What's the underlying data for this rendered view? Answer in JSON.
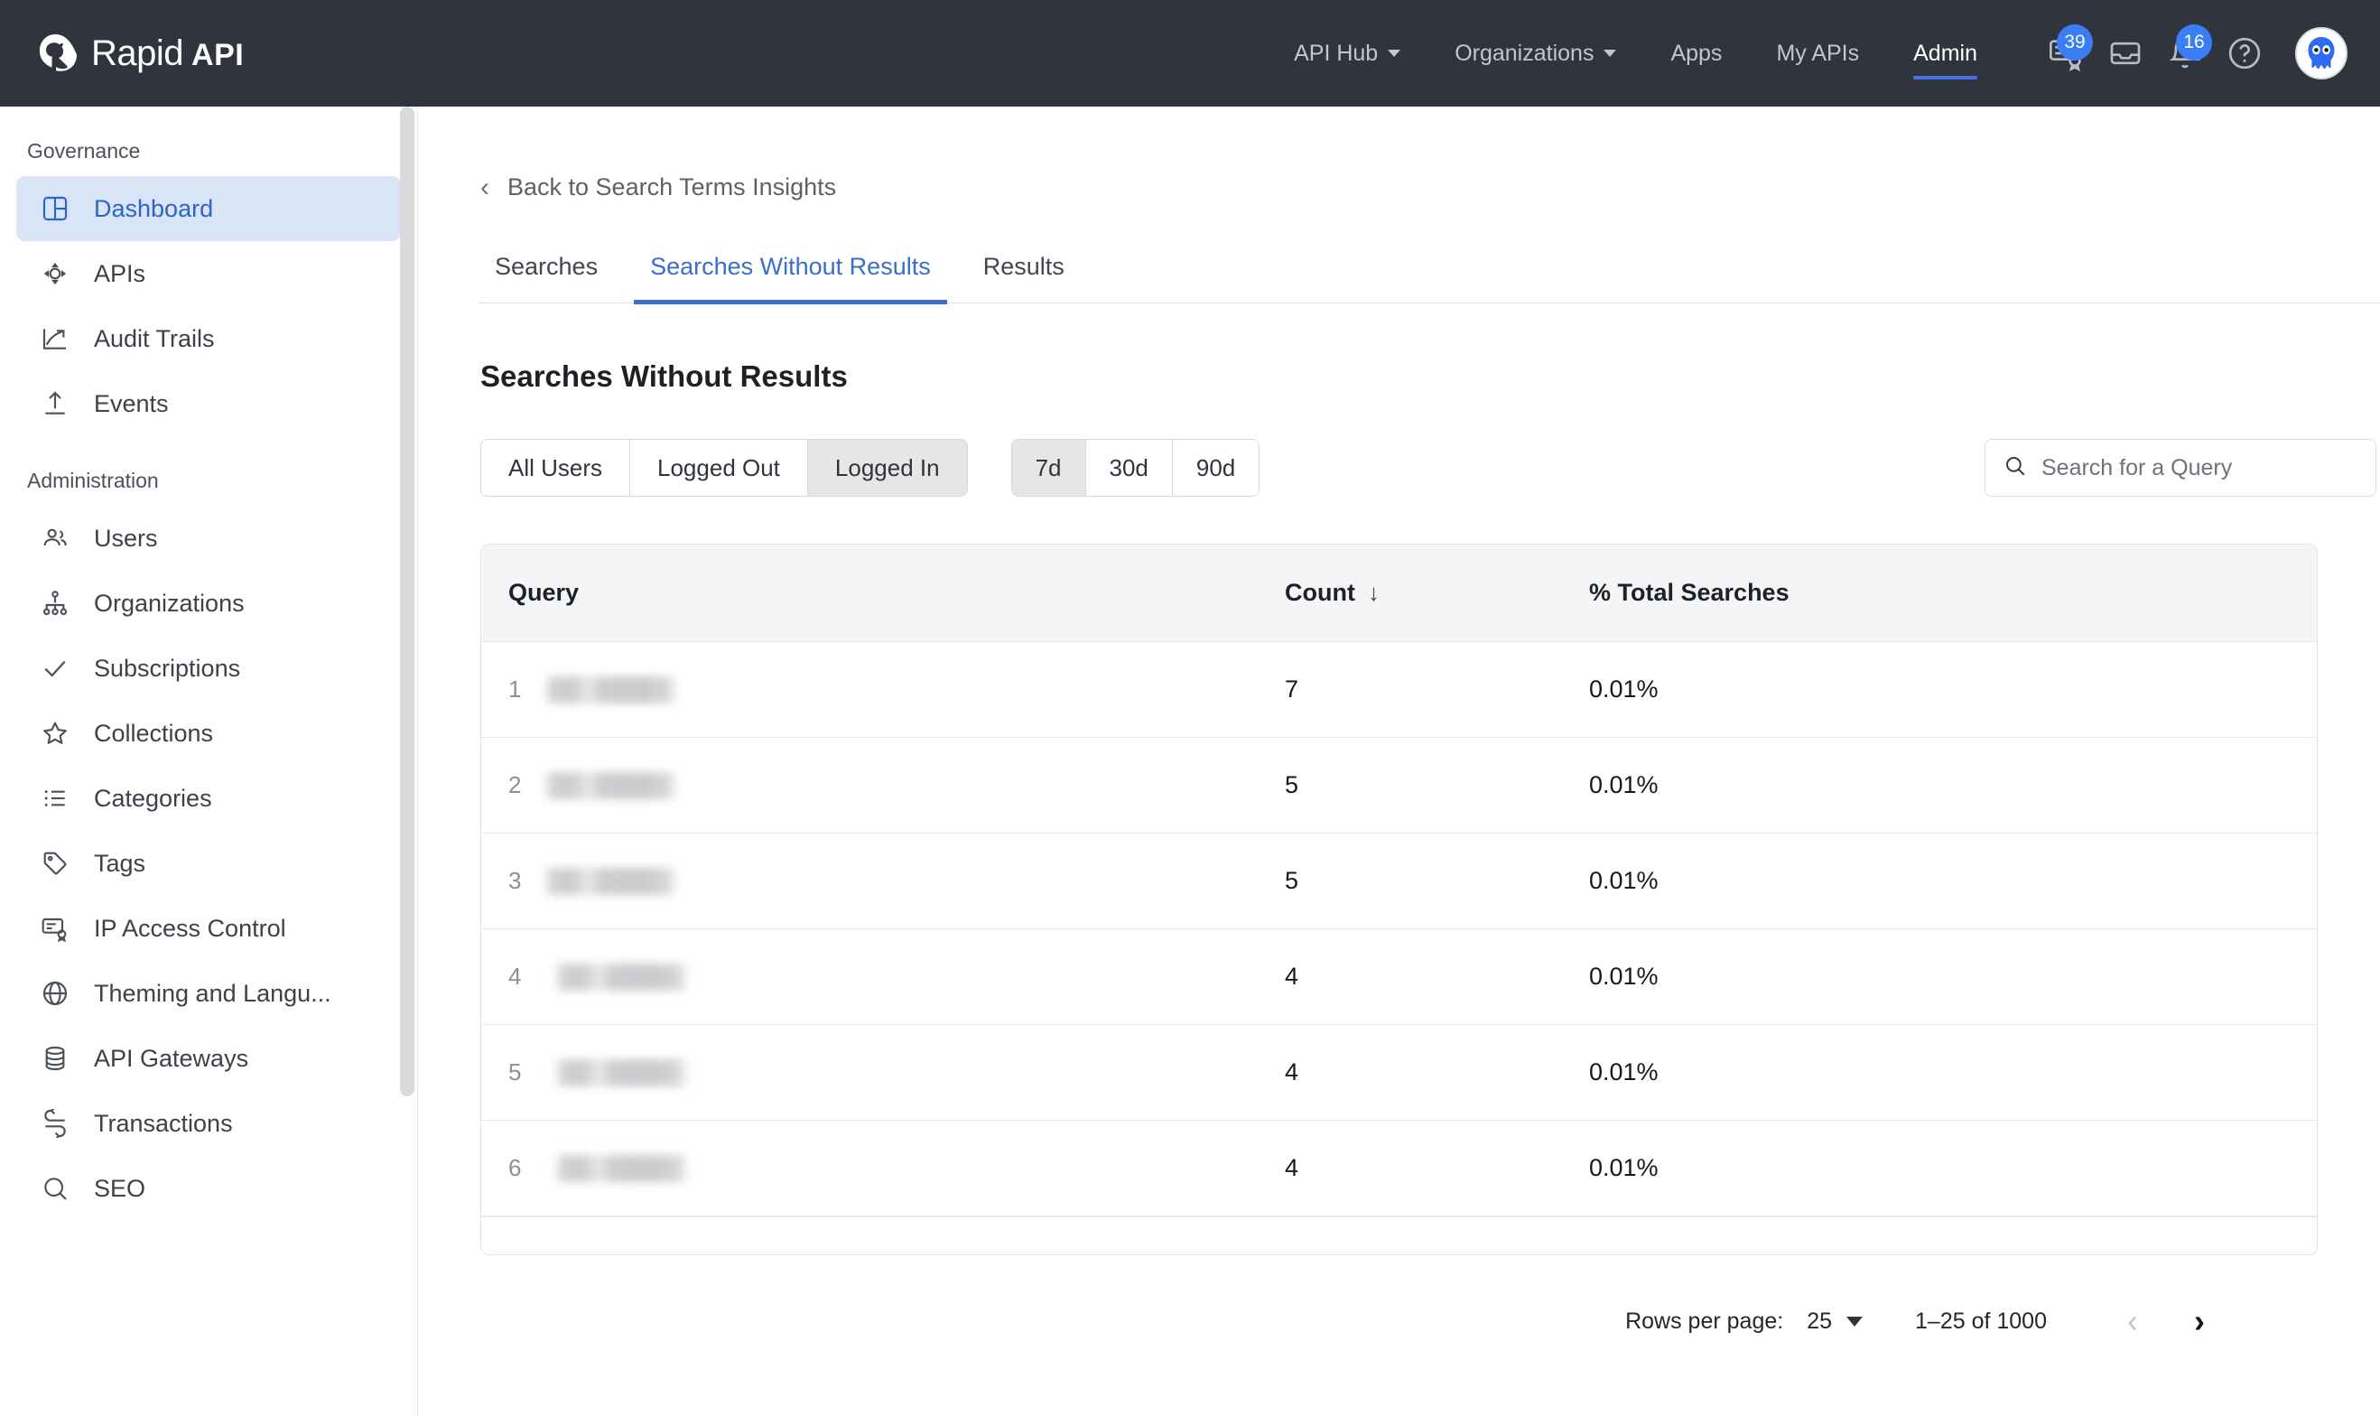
{
  "brand": {
    "name_primary": "Rapid",
    "name_secondary": "API",
    "logo_icon": "rapidapi-logo-icon"
  },
  "topnav": {
    "links": [
      {
        "label": "API Hub",
        "has_caret": true,
        "active": false
      },
      {
        "label": "Organizations",
        "has_caret": true,
        "active": false
      },
      {
        "label": "Apps",
        "has_caret": false,
        "active": false
      },
      {
        "label": "My APIs",
        "has_caret": false,
        "active": false
      },
      {
        "label": "Admin",
        "has_caret": false,
        "active": true
      }
    ],
    "icons": [
      {
        "name": "certificate-icon",
        "badge": "39"
      },
      {
        "name": "inbox-icon",
        "badge": ""
      },
      {
        "name": "bell-icon",
        "badge": "16"
      },
      {
        "name": "help-circle-icon",
        "badge": ""
      }
    ],
    "avatar_alt": "user-avatar"
  },
  "sidebar": {
    "groups": [
      {
        "label": "Governance",
        "items": [
          {
            "label": "Dashboard",
            "icon": "dashboard-icon",
            "active": true
          },
          {
            "label": "APIs",
            "icon": "api-icon",
            "active": false
          },
          {
            "label": "Audit Trails",
            "icon": "trend-up-icon",
            "active": false
          },
          {
            "label": "Events",
            "icon": "upload-icon",
            "active": false
          }
        ]
      },
      {
        "label": "Administration",
        "items": [
          {
            "label": "Users",
            "icon": "users-icon",
            "active": false
          },
          {
            "label": "Organizations",
            "icon": "org-tree-icon",
            "active": false
          },
          {
            "label": "Subscriptions",
            "icon": "check-icon",
            "active": false
          },
          {
            "label": "Collections",
            "icon": "star-icon",
            "active": false
          },
          {
            "label": "Categories",
            "icon": "list-icon",
            "active": false
          },
          {
            "label": "Tags",
            "icon": "tag-icon",
            "active": false
          },
          {
            "label": "IP Access Control",
            "icon": "certificate-icon",
            "active": false
          },
          {
            "label": "Theming and Langu...",
            "icon": "globe-icon",
            "active": false
          },
          {
            "label": "API Gateways",
            "icon": "database-icon",
            "active": false
          },
          {
            "label": "Transactions",
            "icon": "refresh-icon",
            "active": false
          },
          {
            "label": "SEO",
            "icon": "search-icon",
            "active": false
          }
        ]
      }
    ]
  },
  "main": {
    "back_label": "Back to Search Terms Insights",
    "back_icon": "chevron-left-icon",
    "tabs": [
      {
        "label": "Searches",
        "active": false
      },
      {
        "label": "Searches Without Results",
        "active": true
      },
      {
        "label": "Results",
        "active": false
      }
    ],
    "page_title": "Searches Without Results",
    "user_filter": {
      "options": [
        {
          "label": "All Users",
          "selected": false
        },
        {
          "label": "Logged Out",
          "selected": false
        },
        {
          "label": "Logged In",
          "selected": true
        }
      ]
    },
    "range_filter": {
      "options": [
        {
          "label": "7d",
          "selected": true
        },
        {
          "label": "30d",
          "selected": false
        },
        {
          "label": "90d",
          "selected": false
        }
      ]
    },
    "search": {
      "placeholder": "Search for a Query",
      "value": "",
      "icon": "search-icon"
    },
    "table": {
      "columns": [
        {
          "label": "Query",
          "sorted": false
        },
        {
          "label": "Count",
          "sorted": true,
          "sort_icon": "arrow-down-icon",
          "sort_glyph": "↓"
        },
        {
          "label": "% Total Searches",
          "sorted": false
        }
      ],
      "rows": [
        {
          "rank": "1",
          "query": "",
          "query_redacted": true,
          "redaction_width": 148,
          "count": "7",
          "pct": "0.01%"
        },
        {
          "rank": "2",
          "query": "",
          "query_redacted": true,
          "redaction_width": 148,
          "count": "5",
          "pct": "0.01%"
        },
        {
          "rank": "3",
          "query": "",
          "query_redacted": true,
          "redaction_width": 148,
          "count": "5",
          "pct": "0.01%"
        },
        {
          "rank": "4",
          "query": "",
          "query_redacted": true,
          "redaction_width": 148,
          "count": "4",
          "pct": "0.01%"
        },
        {
          "rank": "5",
          "query": "",
          "query_redacted": true,
          "redaction_width": 148,
          "count": "4",
          "pct": "0.01%"
        },
        {
          "rank": "6",
          "query": "",
          "query_redacted": true,
          "redaction_width": 148,
          "count": "4",
          "pct": "0.01%"
        }
      ]
    },
    "pagination": {
      "rows_per_page_label": "Rows per page:",
      "rows_per_page_value": "25",
      "range_text": "1–25 of 1000",
      "prev_label": "‹",
      "next_label": "›",
      "prev_disabled": true
    }
  },
  "colors": {
    "topnav_bg": "#2f343d",
    "accent_blue": "#3b6ec7",
    "badge_blue": "#3b7df6",
    "sidebar_active_bg": "#d9e4f7",
    "sidebar_active_text": "#2f64c4"
  }
}
